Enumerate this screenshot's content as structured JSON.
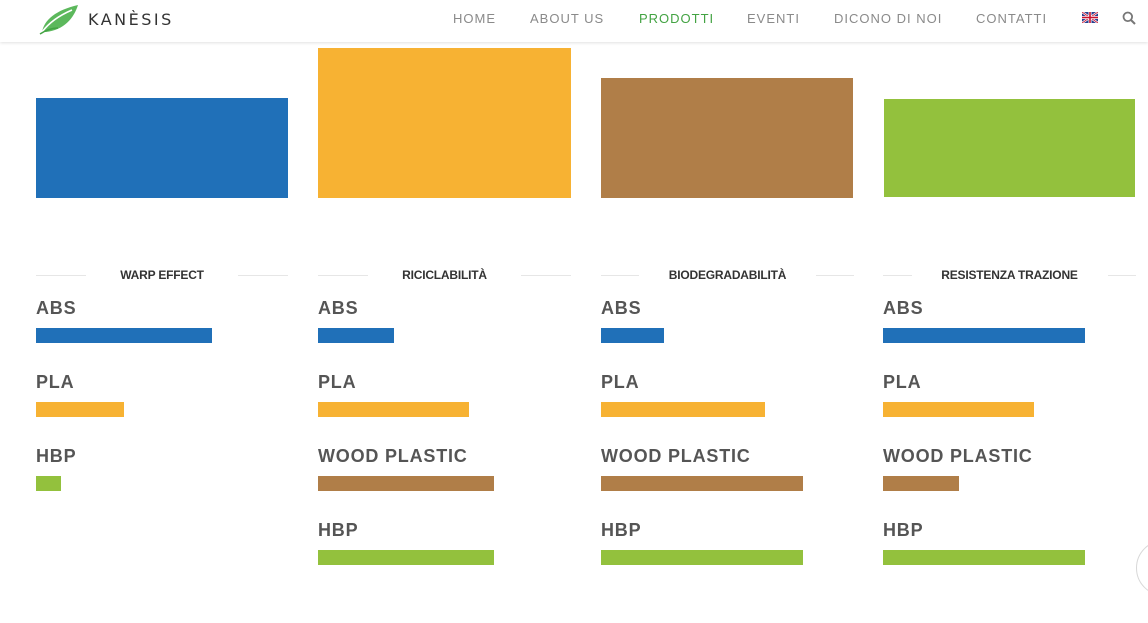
{
  "brand": {
    "name": "KANÈSIS"
  },
  "nav": {
    "items": [
      {
        "label": "HOME",
        "active": false
      },
      {
        "label": "ABOUT US",
        "active": false
      },
      {
        "label": "PRODOTTI",
        "active": true
      },
      {
        "label": "EVENTI",
        "active": false
      },
      {
        "label": "DICONO DI NOI",
        "active": false
      },
      {
        "label": "CONTATTI",
        "active": false
      }
    ],
    "language_icon": "uk-flag-icon",
    "search_icon": "search-icon"
  },
  "colors": {
    "abs": "#2070b8",
    "pla": "#f7b233",
    "wood_plastic": "#b07e48",
    "hbp": "#93c13d",
    "accent": "#43a343"
  },
  "chart_data": [
    {
      "type": "bar",
      "title": "WARP EFFECT",
      "categories": [
        "ABS",
        "PLA",
        "HBP"
      ],
      "values": [
        70,
        35,
        10
      ]
    },
    {
      "type": "bar",
      "title": "RICICLABILITÀ",
      "categories": [
        "ABS",
        "PLA",
        "WOOD PLASTIC",
        "HBP"
      ],
      "values": [
        30,
        60,
        70,
        70
      ]
    },
    {
      "type": "bar",
      "title": "BIODEGRADABILITÀ",
      "categories": [
        "ABS",
        "PLA",
        "WOOD PLASTIC",
        "HBP"
      ],
      "values": [
        25,
        65,
        80,
        80
      ]
    },
    {
      "type": "bar",
      "title": "RESISTENZA TRAZIONE",
      "categories": [
        "ABS",
        "PLA",
        "WOOD PLASTIC",
        "HBP"
      ],
      "values": [
        80,
        60,
        30,
        80
      ]
    }
  ]
}
